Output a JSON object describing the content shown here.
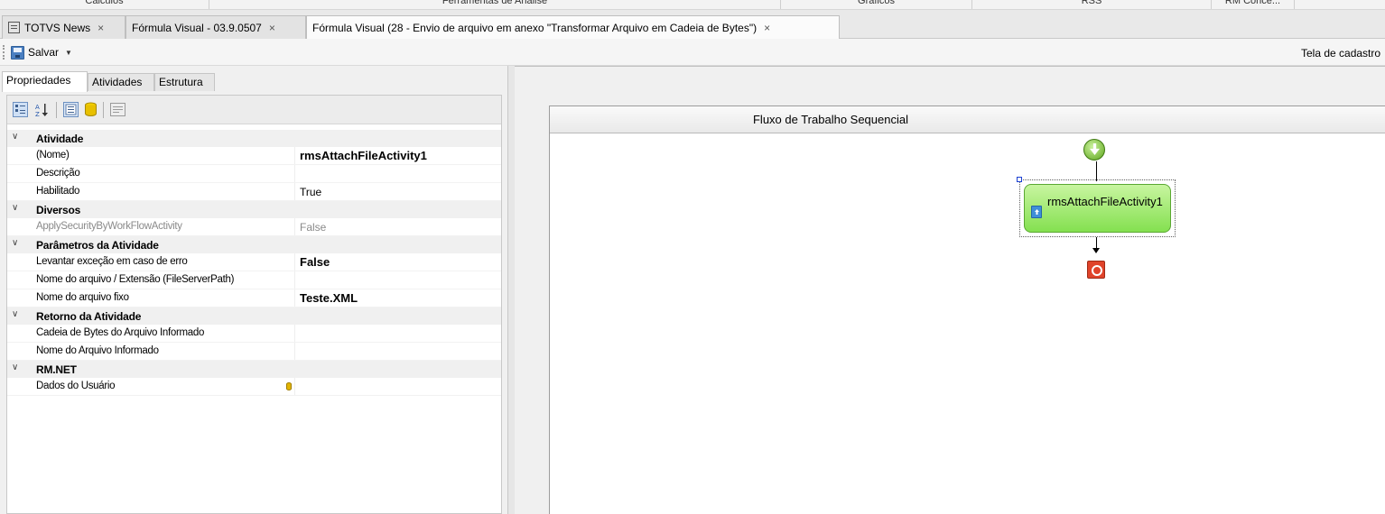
{
  "ribbon": {
    "groups": [
      "Cálculos",
      "Ferramentas de Análise",
      "Gráficos",
      "RSS",
      "RM Conce..."
    ]
  },
  "doc_tabs": [
    {
      "label": "TOTVS News",
      "close": "×"
    },
    {
      "label": "Fórmula Visual - 03.9.0507",
      "close": "×"
    },
    {
      "label": "Fórmula Visual (28 - Envio de arquivo em anexo \"Transformar Arquivo em Cadeia de Bytes\")",
      "close": "×"
    }
  ],
  "toolbar": {
    "save_label": "Salvar",
    "right_label": "Tela de cadastro"
  },
  "panel_tabs": [
    "Propriedades",
    "Atividades",
    "Estrutura"
  ],
  "property_toolbar": {
    "icons": [
      "categorized-icon",
      "alphabetical-icon",
      "properties-icon",
      "database-icon",
      "property-pages-icon"
    ]
  },
  "property_grid": {
    "categories": [
      {
        "label": "Atividade",
        "rows": [
          {
            "name": "(Nome)",
            "value": "rmsAttachFileActivity1",
            "bold": true
          },
          {
            "name": "Descrição",
            "value": ""
          },
          {
            "name": "Habilitado",
            "value": "True"
          }
        ]
      },
      {
        "label": "Diversos",
        "rows": [
          {
            "name": "ApplySecurityByWorkFlowActivity",
            "value": "False",
            "dim": true
          }
        ]
      },
      {
        "label": "Parâmetros da Atividade",
        "rows": [
          {
            "name": "Levantar exceção em caso de erro",
            "value": "False",
            "bold": true
          },
          {
            "name": "Nome do arquivo / Extensão (FileServerPath)",
            "value": ""
          },
          {
            "name": "Nome do arquivo fixo",
            "value": "Teste.XML",
            "bold": true
          }
        ]
      },
      {
        "label": "Retorno da Atividade",
        "rows": [
          {
            "name": "Cadeia de Bytes do Arquivo Informado",
            "value": ""
          },
          {
            "name": "Nome do Arquivo Informado",
            "value": ""
          }
        ]
      },
      {
        "label": "RM.NET",
        "rows": [
          {
            "name": "Dados do Usuário",
            "value": ""
          }
        ]
      }
    ]
  },
  "designer": {
    "header": "Fluxo de Trabalho Sequencial",
    "activity_label": "rmsAttachFileActivity1"
  },
  "colors": {
    "activity_fill": "#84e050",
    "start_green": "#5da51c",
    "end_red": "#e0432a",
    "selection_handle": "#1a3fd1"
  }
}
